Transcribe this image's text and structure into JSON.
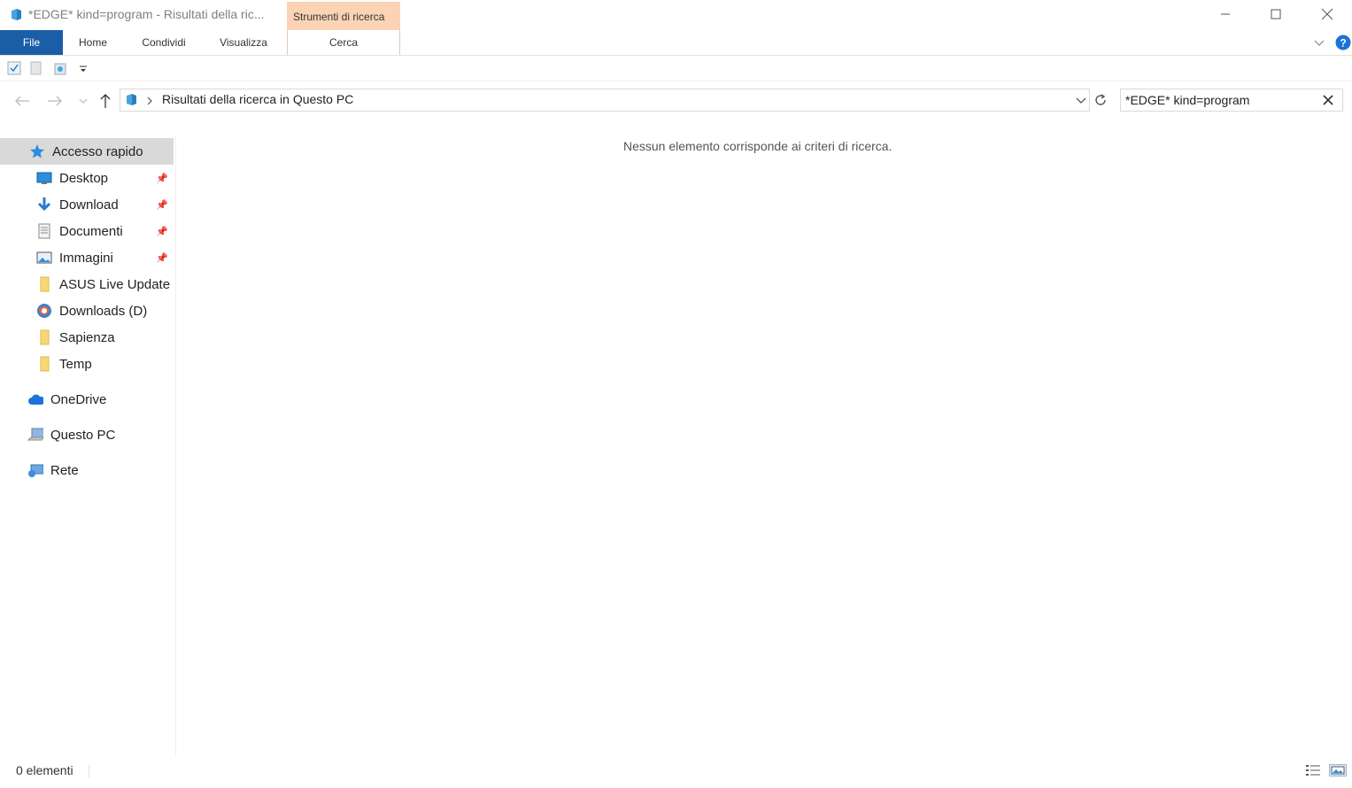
{
  "window": {
    "title": "*EDGE* kind=program - Risultati della ric...",
    "context_tab_header": "Strumenti di ricerca",
    "minimize_icon": "minimize-icon",
    "maximize_icon": "maximize-icon",
    "close_icon": "close-icon"
  },
  "ribbon": {
    "tabs": [
      "File",
      "Home",
      "Condividi",
      "Visualizza",
      "Cerca"
    ]
  },
  "address": {
    "path": "Risultati della ricerca in Questo PC"
  },
  "search": {
    "value": "*EDGE* kind=program"
  },
  "nav": {
    "quick_access": "Accesso rapido",
    "pinned": [
      {
        "label": "Desktop",
        "icon": "desktop-icon"
      },
      {
        "label": "Download",
        "icon": "download-icon"
      },
      {
        "label": "Documenti",
        "icon": "documents-icon"
      },
      {
        "label": "Immagini",
        "icon": "pictures-icon"
      }
    ],
    "recent": [
      {
        "label": "ASUS Live Update",
        "icon": "folder-icon"
      },
      {
        "label": "Downloads (D)",
        "icon": "drive-icon"
      },
      {
        "label": "Sapienza",
        "icon": "folder-icon"
      },
      {
        "label": "Temp",
        "icon": "folder-icon"
      }
    ],
    "onedrive": "OneDrive",
    "this_pc": "Questo PC",
    "network": "Rete"
  },
  "content": {
    "empty_message": "Nessun elemento corrisponde ai criteri di ricerca."
  },
  "status": {
    "count": "0 elementi"
  },
  "colors": {
    "file_tab": "#1b5ea8",
    "context_tab": "#fcd3b4",
    "selected_nav": "#d9d9d9"
  }
}
